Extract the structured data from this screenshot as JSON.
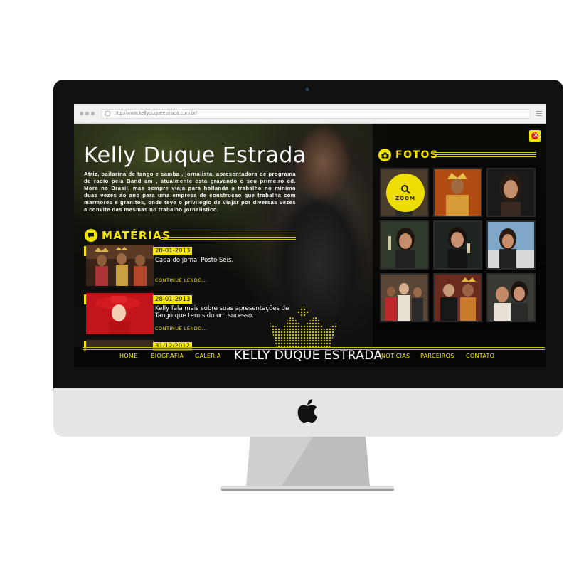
{
  "browser": {
    "url": "http://www.kellyduqueestrada.com.br/"
  },
  "site": {
    "title": "Kelly Duque Estrada",
    "bio": "Atriz, bailarina de tango e samba , jornalista, apresentadora de programa de radio pela Band am , atualmente esta gravando o seu primeiro cd. Mora no Brasil, mas sempre viaja para hollanda a trabalho no minimo duas vezes ao ano para uma empresa de construcao que trabalha com marmores e granitos, onde teve o privilegio de viajar por diversas vezes a convite das mesmas no trabalho jornalistico."
  },
  "materias": {
    "heading": "MATÉRIAS",
    "articles": [
      {
        "date": "28-01-2013",
        "text": "Capa do jornal Posto Seis.",
        "more": "CONTINUE LENDO..."
      },
      {
        "date": "28-01-2013",
        "text": "Kelly fala mais sobre suas apresentações de Tango que tem sido um sucesso.",
        "more": "CONTINUE LENDO..."
      },
      {
        "date": "31/12/2012"
      }
    ]
  },
  "fotos": {
    "heading": "FOTOS",
    "zoom_label": "ZOOM"
  },
  "nav": {
    "home": "HOME",
    "biografia": "BIOGRAFIA",
    "galeria": "GALERIA",
    "brand": "KELLY DUQUE ESTRADA",
    "noticias": "NOTÍCIAS",
    "parceiros": "PARCEIROS",
    "contato": "CONTATO"
  },
  "icons": {
    "close": "close-icon",
    "camera": "camera-icon",
    "comment": "comment-icon",
    "search": "search-icon",
    "apple_logo": "apple-logo-icon"
  },
  "colors": {
    "accent": "#f5e600",
    "page_background": "#0d0d0b",
    "text": "#ffffff"
  }
}
